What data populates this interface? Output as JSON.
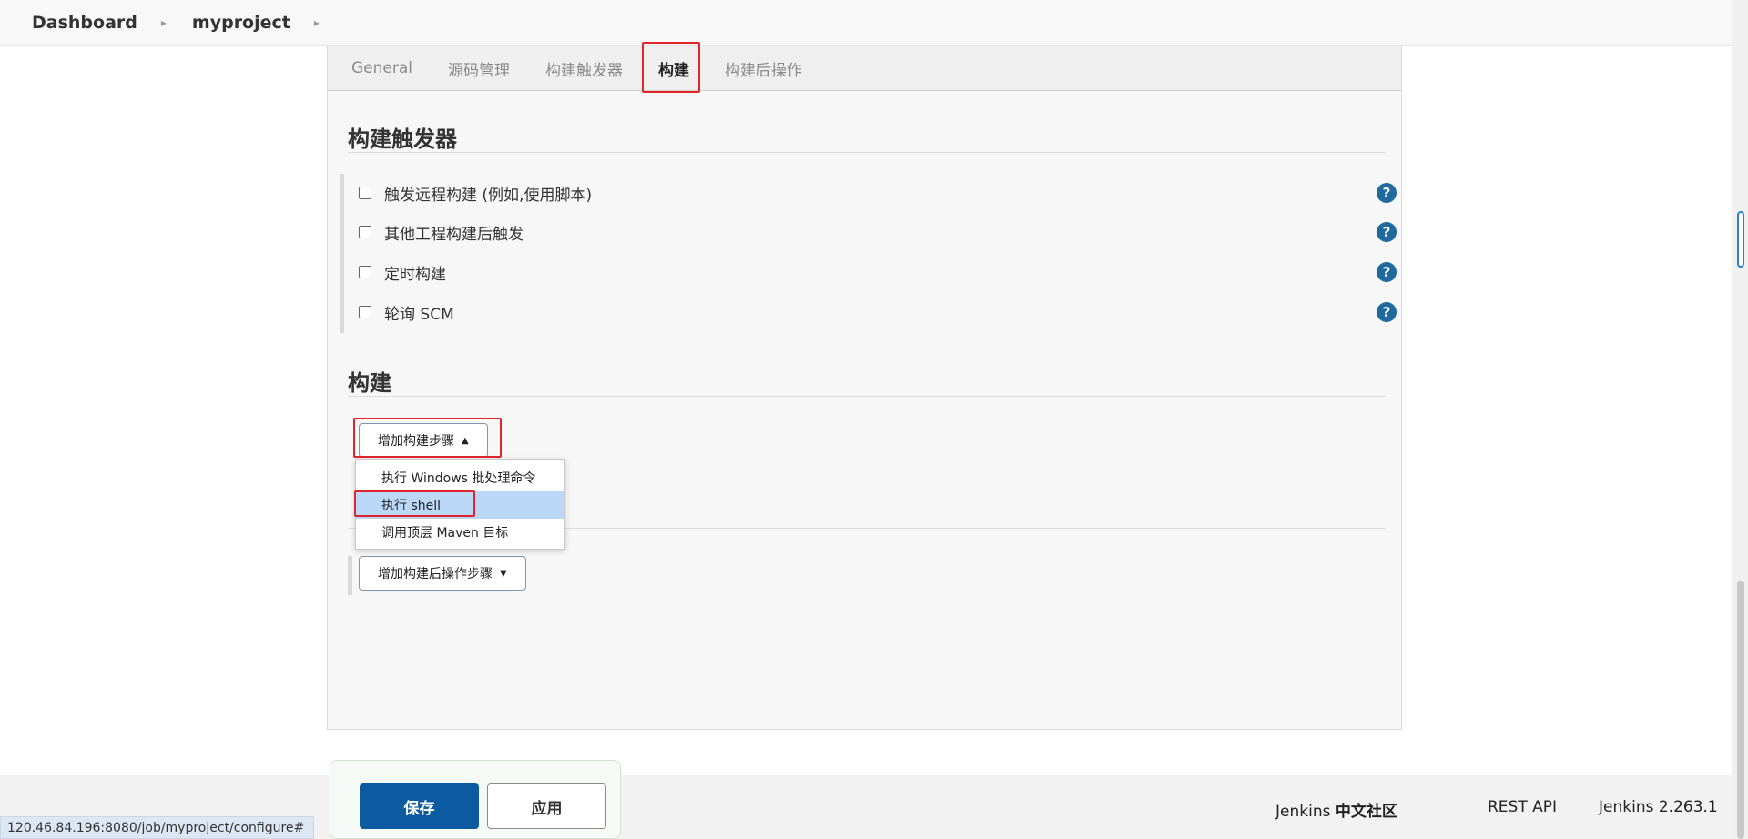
{
  "breadcrumb": {
    "items": [
      "Dashboard",
      "myproject"
    ]
  },
  "tabs": [
    {
      "label": "General",
      "active": false
    },
    {
      "label": "源码管理",
      "active": false
    },
    {
      "label": "构建触发器",
      "active": false
    },
    {
      "label": "构建",
      "active": true
    },
    {
      "label": "构建后操作",
      "active": false
    }
  ],
  "sections": {
    "triggers": {
      "title": "构建触发器",
      "options": [
        {
          "label": "触发远程构建 (例如,使用脚本)",
          "checked": false
        },
        {
          "label": "其他工程构建后触发",
          "checked": false
        },
        {
          "label": "定时构建",
          "checked": false
        },
        {
          "label": "轮询 SCM",
          "checked": false
        }
      ],
      "help_glyph": "?"
    },
    "build": {
      "title": "构建",
      "add_step_label": "增加构建步骤",
      "dropdown": [
        {
          "label": "执行 Windows 批处理命令",
          "highlighted": false
        },
        {
          "label": "执行 shell",
          "highlighted": true
        },
        {
          "label": "调用顶层 Maven 目标",
          "highlighted": false
        }
      ]
    },
    "post_build": {
      "add_step_label": "增加构建后操作步骤"
    }
  },
  "actions": {
    "save_label": "保存",
    "apply_label": "应用"
  },
  "footer": {
    "community_prefix": "Jenkins",
    "community_bold": "中文社区",
    "rest_api": "REST API",
    "version": "Jenkins 2.263.1"
  },
  "status_url": "120.46.84.196:8080/job/myproject/configure#",
  "colors": {
    "accent": "#0c5aa0",
    "help": "#1f6b9f",
    "highlight": "#e0252a",
    "menu_highlight": "#bcd8f8"
  }
}
